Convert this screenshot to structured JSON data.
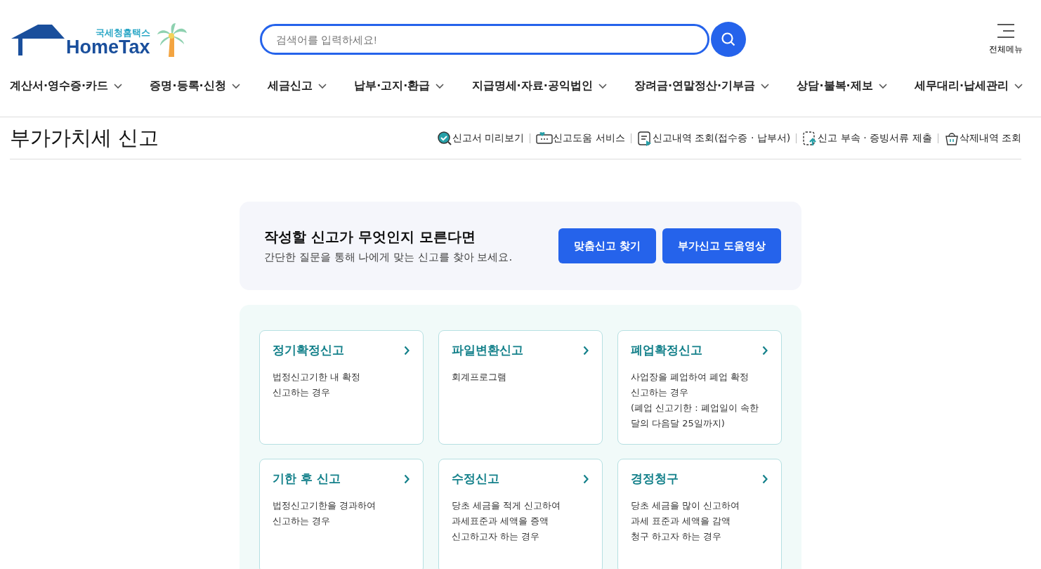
{
  "logo": {
    "subtitle": "국세청홈택스",
    "title": "HomeTax"
  },
  "search": {
    "placeholder": "검색어를 입력하세요!"
  },
  "menu_button": {
    "label": "전체메뉴"
  },
  "nav": [
    {
      "label": "계산서·영수증·카드"
    },
    {
      "label": "증명·등록·신청"
    },
    {
      "label": "세금신고"
    },
    {
      "label": "납부·고지·환급"
    },
    {
      "label": "지급명세·자료·공익법인"
    },
    {
      "label": "장려금·연말정산·기부금"
    },
    {
      "label": "상담·불복·제보"
    },
    {
      "label": "세무대리·납세관리"
    }
  ],
  "page_title": "부가가치세 신고",
  "quick_links": [
    {
      "kind": "preview",
      "label": "신고서 미리보기"
    },
    {
      "kind": "help",
      "label": "신고도움 서비스"
    },
    {
      "kind": "history",
      "label": "신고내역 조회(접수증 · 납부서)"
    },
    {
      "kind": "upload",
      "label": "신고 부속 · 증빙서류 제출"
    },
    {
      "kind": "trash",
      "label": "삭제내역 조회"
    }
  ],
  "guide": {
    "heading": "작성할 신고가 무엇인지 모른다면",
    "text": "간단한 질문을 통해 나에게 맞는 신고를 찾아 보세요.",
    "buttons": [
      "맞춤신고 찾기",
      "부가신고 도움영상"
    ]
  },
  "cards": [
    {
      "title": "정기확정신고",
      "lines": [
        "법정신고기한 내 확정",
        "신고하는 경우"
      ]
    },
    {
      "title": "파일변환신고",
      "lines": [
        "회계프로그램"
      ]
    },
    {
      "title": "폐업확정신고",
      "lines": [
        "사업장을 폐업하여 폐업 확정",
        "신고하는 경우",
        "(폐업 신고기한 : 폐업일이 속한",
        "달의 다음달 25일까지)"
      ]
    },
    {
      "title": "기한 후 신고",
      "lines": [
        "법정신고기한을 경과하여",
        "신고하는 경우"
      ]
    },
    {
      "title": "수정신고",
      "lines": [
        "당초 세금을 적게 신고하여",
        "과세표준과 세액을 증액",
        "신고하고자 하는 경우"
      ]
    },
    {
      "title": "경정청구",
      "lines": [
        "당초 세금을 많이 신고하여",
        "과세 표준과 세액을 감액",
        "청구 하고자 하는 경우"
      ]
    }
  ]
}
